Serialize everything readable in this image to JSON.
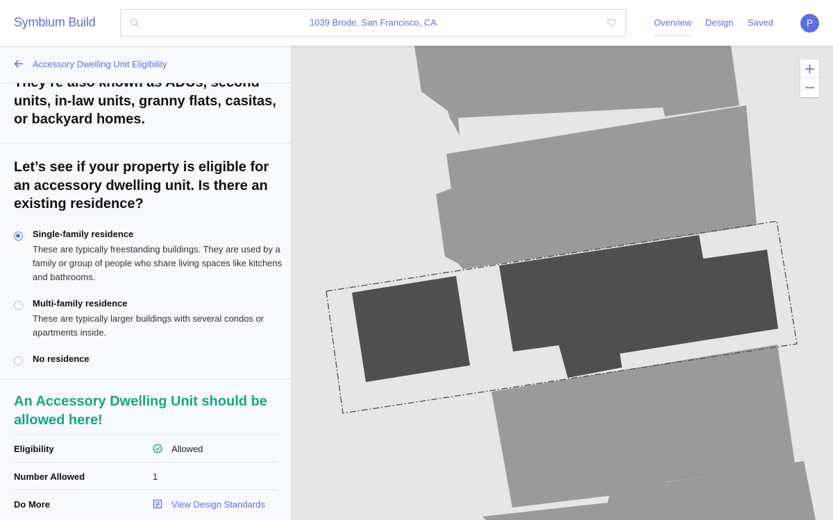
{
  "header": {
    "logo": "Symbium Build",
    "address": "1039 Brode, San Francisco, CA",
    "nav": [
      "Overview",
      "Design",
      "Saved"
    ],
    "avatar_initial": "P"
  },
  "sidebar": {
    "back_title": "Accessory Dwelling Unit Eligibility",
    "intro": "They’re also known as ADUs, second units, in-law units, granny flats, casitas, or backyard homes.",
    "question": "Let’s see if your property is eligible for an accessory dwelling unit.  Is there an existing residence?",
    "options": [
      {
        "title": "Single-family residence",
        "desc": "These are typically freestanding buildings. They are used by a family or group of people who share living spaces like kitchens and bathrooms.",
        "selected": true
      },
      {
        "title": "Multi-family residence",
        "desc": "These are typically larger buildings with several condos or apartments inside.",
        "selected": false
      },
      {
        "title": "No residence",
        "desc": "",
        "selected": false
      }
    ],
    "result": "An Accessory Dwelling Unit should be allowed here!",
    "details": [
      {
        "label": "Eligibility",
        "value": "Allowed",
        "icon": "check-circle-icon"
      },
      {
        "label": "Number Allowed",
        "value": "1"
      },
      {
        "label": "Do More",
        "value": "View Design Standards",
        "icon": "document-icon"
      }
    ]
  },
  "colors": {
    "accent": "#5c6fe0",
    "success": "#1aa583",
    "map_bg": "#e6e6e6",
    "building_light": "#9a9a9a",
    "building_dark": "#4f4f4f"
  }
}
